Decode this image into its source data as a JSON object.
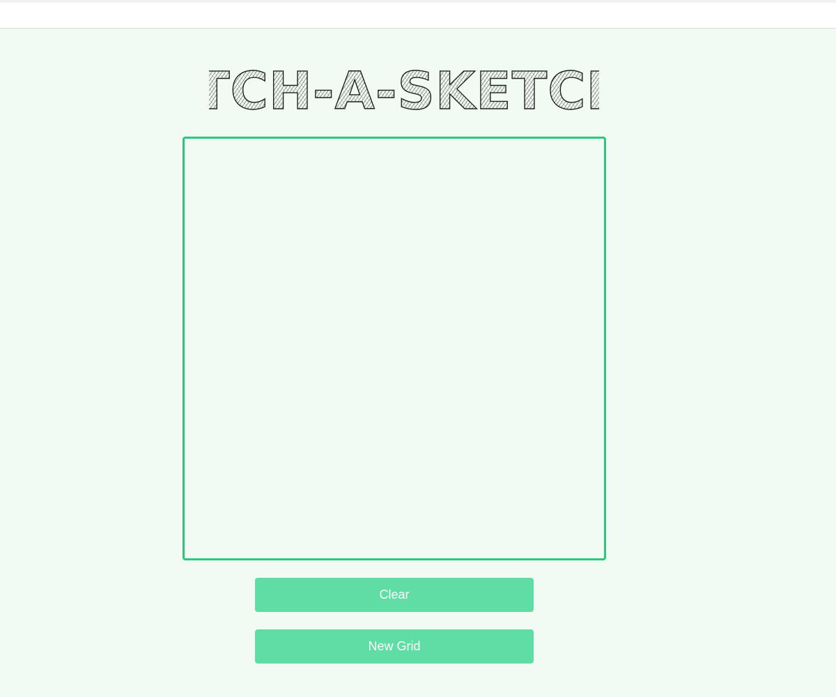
{
  "title": "ETCH-A-SKETCH",
  "buttons": {
    "clear_label": "Clear",
    "new_grid_label": "New Grid"
  },
  "colors": {
    "page_background": "#f1fbf4",
    "board_border": "#27c97f",
    "button_background": "#5fdda5",
    "button_text": "#ffffff",
    "title_ink": "#222222"
  }
}
